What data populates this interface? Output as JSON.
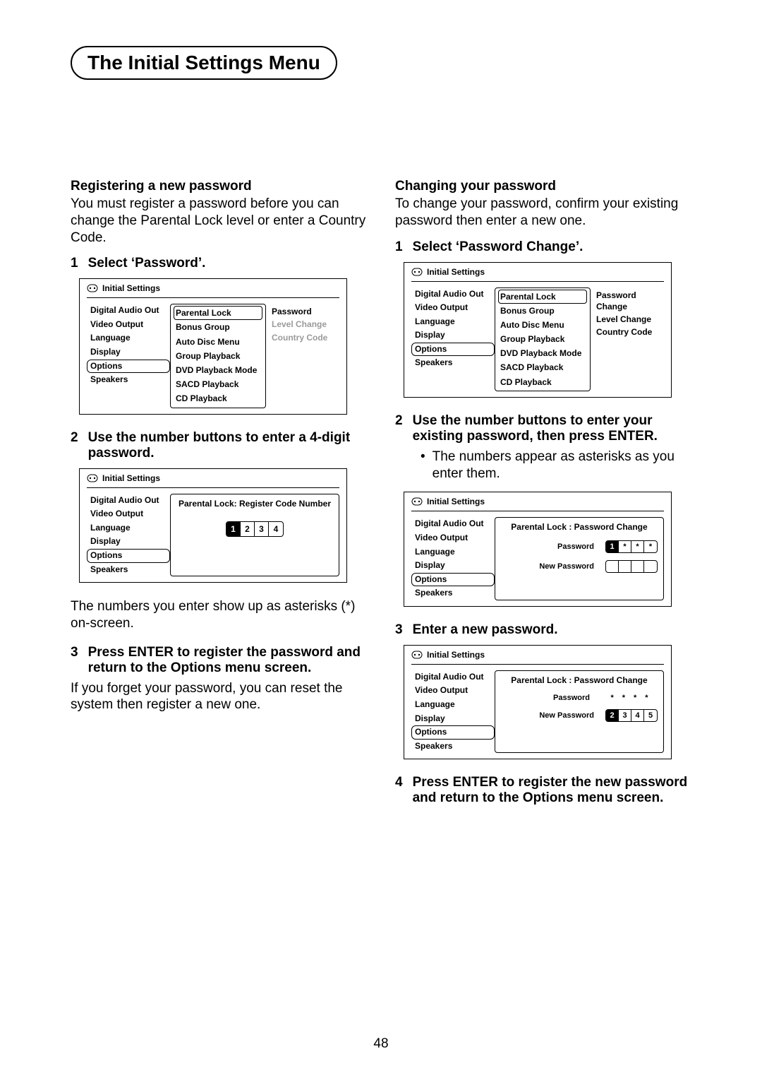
{
  "page_title": "The Initial Settings Menu",
  "page_number": "48",
  "osd_title": "Initial Settings",
  "sidebar_items": [
    "Digital Audio Out",
    "Video Output",
    "Language",
    "Display",
    "Options",
    "Speakers"
  ],
  "mid_items": [
    "Parental Lock",
    "Bonus Group",
    "Auto Disc Menu",
    "Group Playback",
    "DVD Playback Mode",
    "SACD Playback",
    "CD Playback"
  ],
  "left": {
    "heading": "Registering a new password",
    "intro": "You must register a password before you can change the Parental Lock level or enter a Country Code.",
    "step1": {
      "num": "1",
      "text": "Select ‘Password’."
    },
    "menu_right_items": [
      {
        "label": "Password",
        "dim": false
      },
      {
        "label": "Level Change",
        "dim": true
      },
      {
        "label": "Country Code",
        "dim": true
      }
    ],
    "step2": {
      "num": "2",
      "text": "Use the number buttons to enter a 4-digit password."
    },
    "register_panel": {
      "title": "Parental Lock: Register Code Number",
      "digits": [
        "1",
        "2",
        "3",
        "4"
      ]
    },
    "after_step2": "The numbers you enter show up as asterisks (*) on-screen.",
    "step3": {
      "num": "3",
      "text": "Press ENTER to register the password and return to the Options menu screen."
    },
    "after_step3": "If you forget your password, you can reset the system then register a new one."
  },
  "right": {
    "heading": "Changing your password",
    "intro": "To change your password, confirm your existing password then enter a new one.",
    "step1": {
      "num": "1",
      "text": "Select ‘Password Change’."
    },
    "menu_right_items": [
      {
        "label": "Password Change",
        "dim": false
      },
      {
        "label": "Level Change",
        "dim": false
      },
      {
        "label": "Country Code",
        "dim": false
      }
    ],
    "step2": {
      "num": "2",
      "text": "Use the number buttons to enter your existing password, then press ENTER."
    },
    "bullet": "The numbers appear as asterisks as you enter them.",
    "pc_panel_a": {
      "title": "Parental Lock : Password Change",
      "password_label": "Password",
      "password_digits": [
        "1",
        "*",
        "*",
        "*"
      ],
      "new_label": "New Password",
      "new_digits": [
        "",
        "",
        "",
        ""
      ]
    },
    "step3": {
      "num": "3",
      "text": "Enter a new password."
    },
    "pc_panel_b": {
      "title": "Parental Lock : Password Change",
      "password_label": "Password",
      "password_dots": [
        "*",
        "*",
        "*",
        "*"
      ],
      "new_label": "New Password",
      "new_digits": [
        "2",
        "3",
        "4",
        "5"
      ]
    },
    "step4": {
      "num": "4",
      "text": "Press ENTER to register the new password and return to the Options menu screen."
    }
  }
}
